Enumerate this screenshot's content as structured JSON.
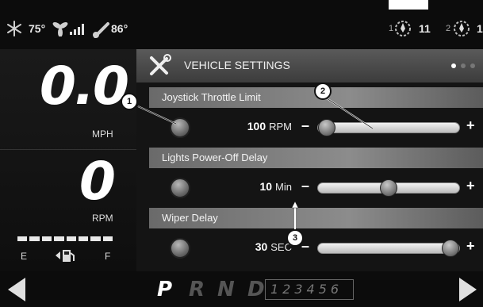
{
  "status": {
    "temperature_inside": "75°",
    "temperature_outside": "86°",
    "seat_1_label": "1",
    "seat_1_value": "11",
    "seat_2_label": "2",
    "seat_2_value": "1"
  },
  "gauges": {
    "speed_value": "0.0",
    "speed_unit": "MPH",
    "rpm_value": "0",
    "rpm_unit": "RPM",
    "fuel_empty": "E",
    "fuel_full": "F"
  },
  "settings": {
    "title": "VEHICLE SETTINGS",
    "items": [
      {
        "label": "Joystick Throttle Limit",
        "value": "100",
        "unit": "RPM",
        "minus": "–",
        "plus": "+",
        "level": 0.0
      },
      {
        "label": "Lights Power-Off Delay",
        "value": "10",
        "unit": "Min",
        "minus": "–",
        "plus": "+",
        "level": 0.5
      },
      {
        "label": "Wiper Delay",
        "value": "30",
        "unit": "SEC",
        "minus": "–",
        "plus": "+",
        "level": 1.0
      }
    ]
  },
  "callouts": [
    "1",
    "2",
    "3"
  ],
  "gears": {
    "p": "P",
    "r": "R",
    "n": "N",
    "d": "D",
    "numbers": "123456"
  },
  "colors": {
    "background": "#0c0c0c",
    "header": "#4a4a4a",
    "section": "#7a7a7a",
    "active_gear": "#ffffff",
    "inactive_gear": "#555555"
  }
}
